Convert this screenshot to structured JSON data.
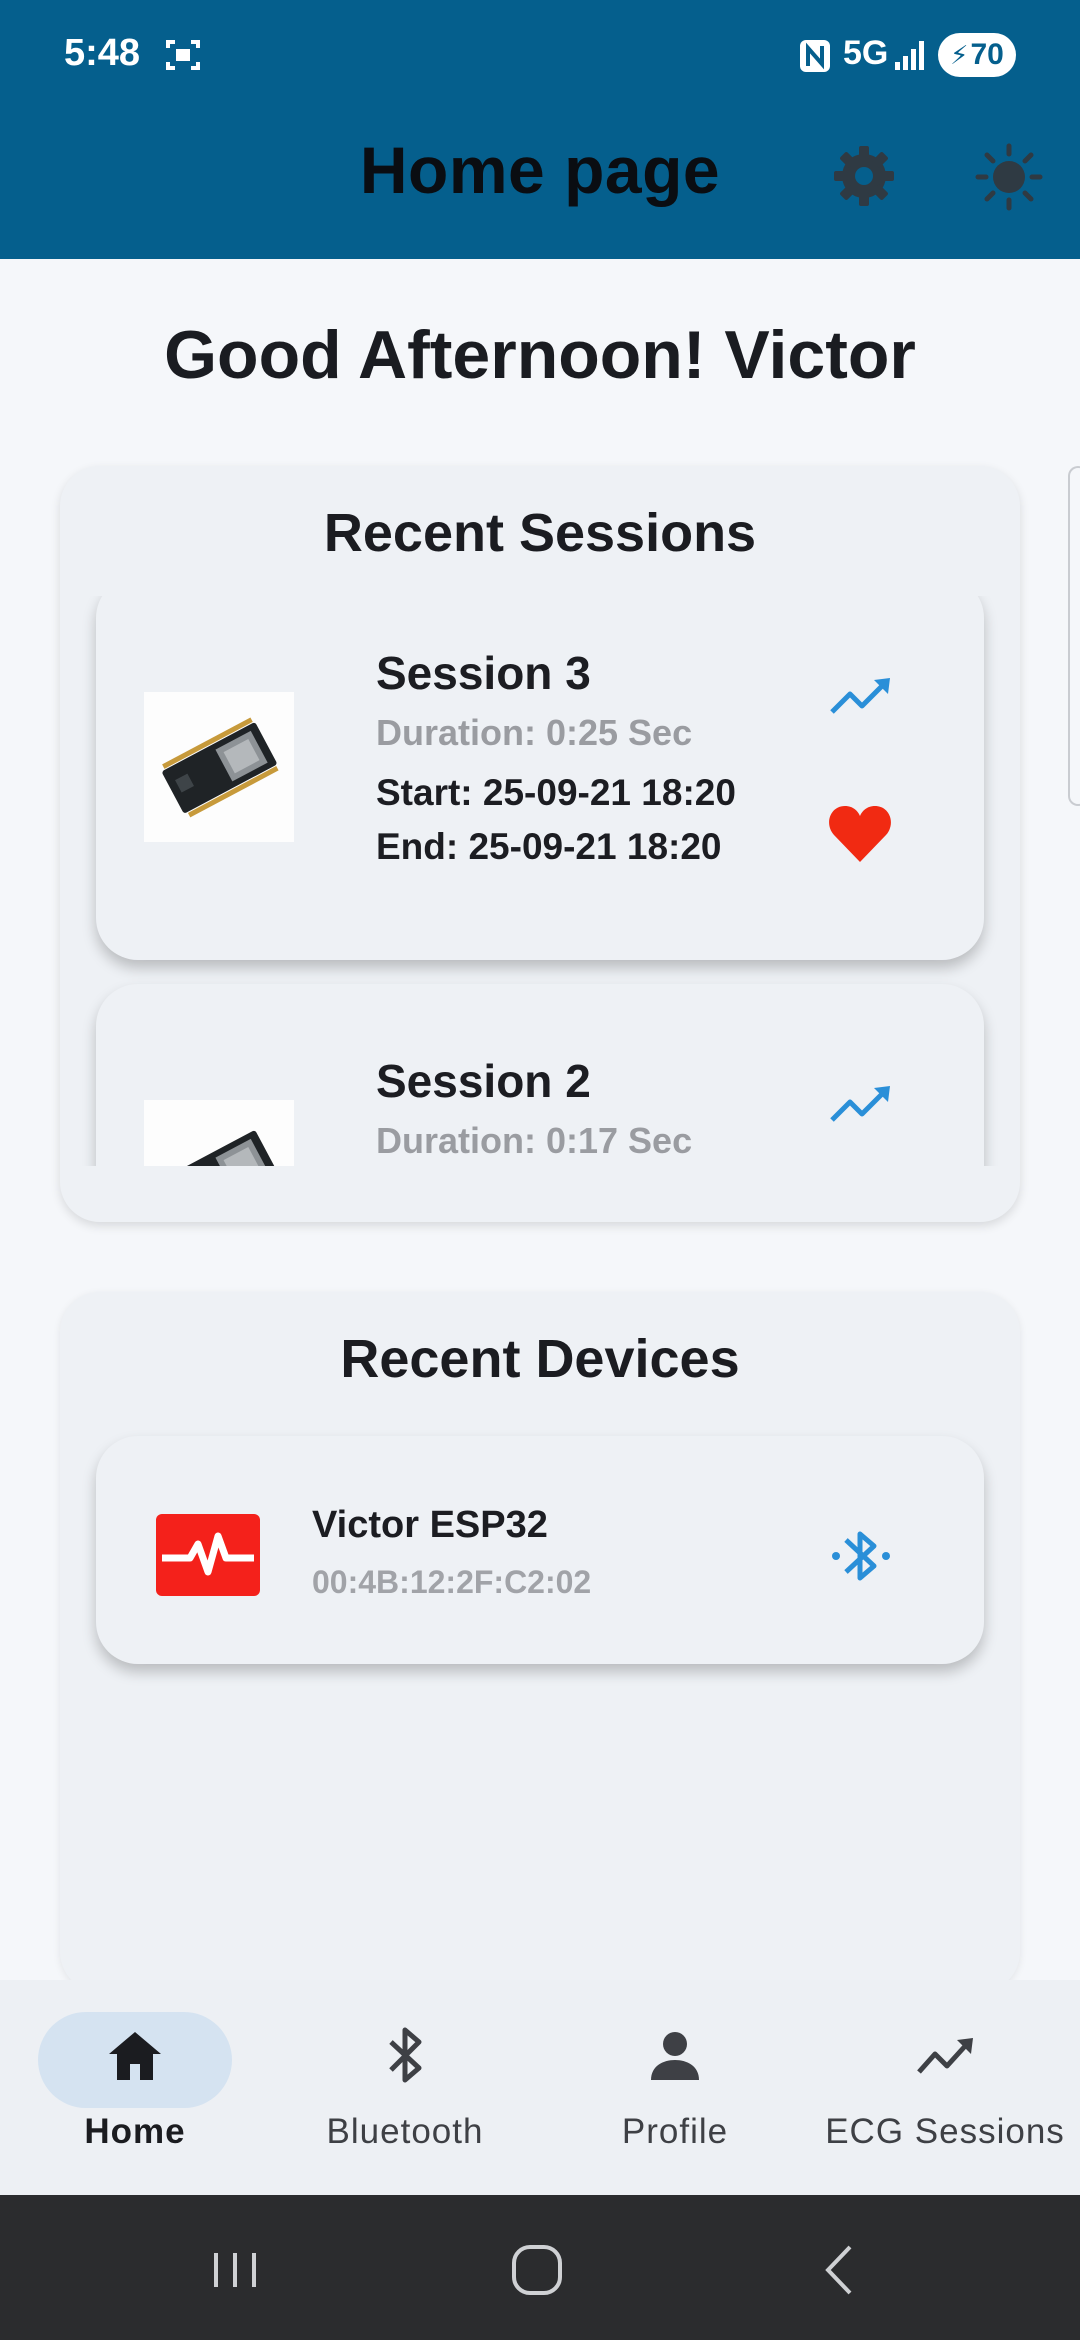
{
  "status_bar": {
    "time": "5:48",
    "network": "5G",
    "battery": "70"
  },
  "header": {
    "title": "Home page",
    "settings_icon": "gear-icon",
    "theme_icon": "sun-icon"
  },
  "greeting": "Good Afternoon! Victor",
  "recent_sessions": {
    "title": "Recent Sessions",
    "items": [
      {
        "name": "Session 3",
        "duration": "Duration: 0:25 Sec",
        "start": "Start: 25-09-21 18:20",
        "end": "End: 25-09-21 18:20",
        "favorite": true
      },
      {
        "name": "Session 2",
        "duration": "Duration: 0:17 Sec"
      }
    ]
  },
  "recent_devices": {
    "title": "Recent Devices",
    "items": [
      {
        "name": "Victor ESP32",
        "mac": "00:4B:12:2F:C2:02"
      }
    ]
  },
  "bottom_nav": {
    "items": [
      {
        "label": "Home",
        "icon": "home-icon",
        "active": true
      },
      {
        "label": "Bluetooth",
        "icon": "bluetooth-icon"
      },
      {
        "label": "Profile",
        "icon": "person-icon"
      },
      {
        "label": "ECG Sessions",
        "icon": "trending-icon"
      }
    ]
  },
  "colors": {
    "header": "#055f8d",
    "accent_blue": "#2a8fd8",
    "heart_red": "#f12a12",
    "device_red": "#f4211b"
  }
}
